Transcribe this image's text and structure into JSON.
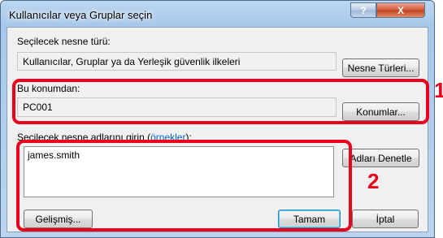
{
  "window": {
    "title": "Kullanıcılar veya Gruplar seçin",
    "help_glyph": "?",
    "close_glyph": "X"
  },
  "object_type": {
    "label": "Seçilecek nesne türü:",
    "value": "Kullanıcılar, Gruplar ya da Yerleşik güvenlik ilkeleri",
    "button": "Nesne Türleri..."
  },
  "location": {
    "label": "Bu konumdan:",
    "value": "PC001",
    "button": "Konumlar..."
  },
  "names": {
    "label_prefix": "Seçilecek nesne adlarını girin (",
    "label_link": "örnekler",
    "label_suffix": "):",
    "value": "james.smith",
    "check_button": "Adları Denetle"
  },
  "footer": {
    "advanced_button": "Gelişmiş...",
    "ok_button": "Tamam",
    "cancel_button": "İptal"
  },
  "callouts": {
    "first": "1",
    "second": "2"
  },
  "colors": {
    "highlight": "#e8001c"
  }
}
